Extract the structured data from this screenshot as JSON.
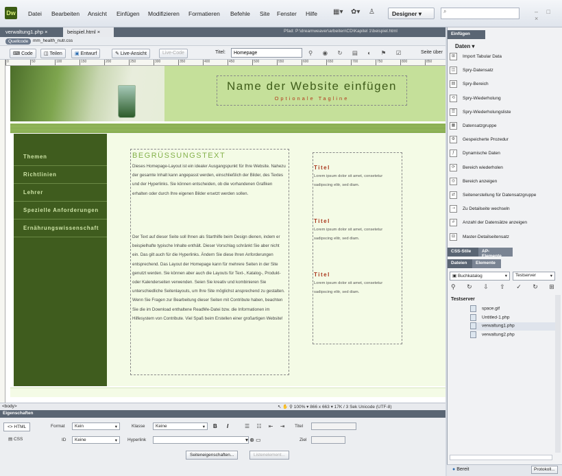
{
  "app": {
    "logo": "Dw"
  },
  "menu": [
    "Datei",
    "Bearbeiten",
    "Ansicht",
    "Einfügen",
    "Modifizieren",
    "Formatieren",
    "Befehle",
    "Site",
    "Fenster",
    "Hilfe"
  ],
  "workspace": "Designer",
  "tabs": [
    {
      "label": "verwaltung1.php",
      "close": "×"
    },
    {
      "label": "beispiel.html",
      "close": "×"
    }
  ],
  "path": "Pfad: P:\\dreamweaver\\arbeiten\\CD\\Kapitel 1\\beispiel.html",
  "related": {
    "source": "Quellcode",
    "file": "mm_health_nutr.css"
  },
  "viewbar": {
    "code": "Code",
    "split": "Teilen",
    "design": "Entwurf",
    "live": "Live-Ansicht",
    "livecode": "Live-Code",
    "title_label": "Titel:",
    "title_value": "Homepage",
    "tail": "Seite über"
  },
  "ruler": [
    "0",
    "50",
    "100",
    "150",
    "200",
    "250",
    "300",
    "350",
    "400",
    "450",
    "500",
    "550",
    "600",
    "650",
    "700",
    "750",
    "800",
    "850"
  ],
  "page": {
    "site_name": "Name der Website einfügen",
    "tagline": "Optionale Tagline",
    "nav": [
      "Themen",
      "Richtlinien",
      "Lehrer",
      "Spezielle Anforderungen",
      "Ernährungswissenschaft"
    ],
    "welcome": "BEGRÜSSUNGSTEXT",
    "para1": "Dieses Homepage-Layout ist ein idealer Ausgangspunkt für Ihre Website. Nahezu der gesamte Inhalt kann angepasst werden, einschließlich der Bilder, des Textes und der Hyperlinks. Sie können entscheiden, ob die vorhandenen Grafiken erhalten oder durch Ihre eigenen Bilder ersetzt werden sollen.",
    "para2": "Der Text auf dieser Seite soll Ihnen als Starthilfe beim Design dienen, indem er beispielhafte typische Inhalte enthält. Dieser Vorschlag schränkt Sie aber nicht ein. Das gilt auch für die Hyperlinks. Ändern Sie diese Ihren Anforderungen entsprechend. Das Layout der Homepage kann für mehrere Seiten in der Site genutzt werden. Sie können aber auch die Layouts für Text-, Katalog-, Produkt- oder Kalenderseiten verwenden. Seien Sie kreativ und kombinieren Sie unterschiedliche Seitenlayouts, um Ihre Site möglichst ansprechend zu gestalten. Wenn Sie Fragen zur Bearbeitung dieser Seiten mit Contribute haben, beachten Sie die im Download enthaltene ReadMe-Datei bzw. die Informationen im Hilfesystem von Contribute. Viel Spaß beim Erstellen einer großartigen Website!",
    "side": [
      {
        "title": "Titel",
        "text": "Lorem ipsum dolor sit amet, consetetur sadipscing elitr, sed diam."
      },
      {
        "title": "Titel",
        "text": "Lorem ipsum dolor sit amet, consetetur sadipscing elitr, sed diam."
      },
      {
        "title": "Titel",
        "text": "Lorem ipsum dolor sit amet, consetetur sadipscing elitr, sed diam."
      }
    ]
  },
  "status": {
    "tag": "<body>",
    "zoom": "100%",
    "size": "866 x 663",
    "weight": "17K / 3 Sek",
    "enc": "Unicode (UTF-8)"
  },
  "properties": {
    "header": "Eigenschaften",
    "html": "HTML",
    "css": "CSS",
    "format_label": "Format",
    "format_value": "Kein",
    "id_label": "ID",
    "id_value": "Keine",
    "class_label": "Klasse",
    "class_value": "Keine",
    "link_label": "Hyperlink",
    "title_label": "Titel",
    "target_label": "Ziel",
    "page_props": "Seiteneigenschaften...",
    "list_item": "Listenelement..."
  },
  "insert_panel": {
    "header": "Einfügen",
    "category": "Daten",
    "items": [
      "Import Tabular Data",
      "Spry-Datensatz",
      "Spry-Bereich",
      "Spry-Wiederholung",
      "Spry-Wiederholungsliste",
      "Datensatzgruppe",
      "Gespeicherte Prozedur",
      "Dynamische Daten",
      "Bereich wiederholen",
      "Bereich anzeigen",
      "Seitenerstellung für Datensatzgruppe",
      "Zu Detailseite wechseln",
      "Anzahl der Datensätze anzeigen",
      "Master-Detailseitensatz"
    ]
  },
  "css_tabs": [
    "CSS-Stile",
    "AP-Elemente"
  ],
  "files_tabs": [
    "Dateien",
    "Elemente"
  ],
  "files": {
    "site": "Buchkatalog",
    "server": "Testserver",
    "root": "Testserver",
    "items": [
      "space.gif",
      "Untitled-1.php",
      "verwaltung1.php",
      "verwaltung2.php"
    ]
  },
  "panel_status": {
    "ready": "Bereit",
    "log": "Protokoll..."
  }
}
